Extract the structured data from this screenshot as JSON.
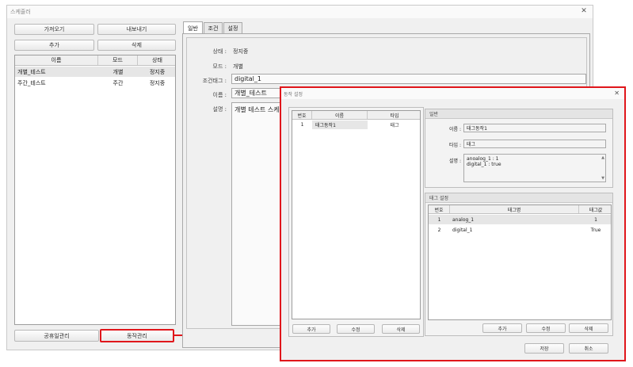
{
  "window": {
    "title": "스케줄러",
    "close_glyph": "✕"
  },
  "left_panel": {
    "import_label": "가져오기",
    "export_label": "내보내기",
    "add_label": "추가",
    "delete_label": "삭제",
    "columns": [
      "이름",
      "모드",
      "상태"
    ],
    "rows": [
      {
        "name": "개별_테스트",
        "mode": "개별",
        "status": "정지중"
      },
      {
        "name": "주간_테스트",
        "mode": "주간",
        "status": "정지중"
      }
    ],
    "holiday_label": "공휴일관리",
    "action_label": "동작관리"
  },
  "tabs": [
    "일반",
    "조건",
    "설정"
  ],
  "general": {
    "status_label": "상태 :",
    "status_value": "정지중",
    "mode_label": "모드 :",
    "mode_value": "개별",
    "cond_tag_label": "조건태그 :",
    "cond_tag_value": "digital_1",
    "name_label": "이름 :",
    "name_value": "개별_테스트",
    "desc_label": "설명 :",
    "desc_value": "개별 테스트 스케줄"
  },
  "dialog": {
    "title": "동작 설정",
    "close_glyph": "✕",
    "list_columns": [
      "번호",
      "이름",
      "타입"
    ],
    "list_rows": [
      {
        "no": "1",
        "name": "태그동작1",
        "type": "태그"
      }
    ],
    "list_add": "추가",
    "list_edit": "수정",
    "list_delete": "삭제",
    "general_group": "일반",
    "name_label": "이름 :",
    "name_value": "태그동작1",
    "type_label": "타입 :",
    "type_value": "태그",
    "desc_label": "설명 :",
    "desc_line1": "anoalog_1 : 1",
    "desc_line2": "digital_1 : true",
    "tag_group": "태그 설정",
    "tag_columns": [
      "번호",
      "태그명",
      "태그값"
    ],
    "tag_rows": [
      {
        "no": "1",
        "tag": "analog_1",
        "value": "1"
      },
      {
        "no": "2",
        "tag": "digital_1",
        "value": "True"
      }
    ],
    "tag_add": "추가",
    "tag_edit": "수정",
    "tag_delete": "삭제",
    "save_label": "저장",
    "cancel_label": "취소"
  },
  "colors": {
    "highlight": "#e0161b",
    "selected_row": "#e6e6e6"
  }
}
